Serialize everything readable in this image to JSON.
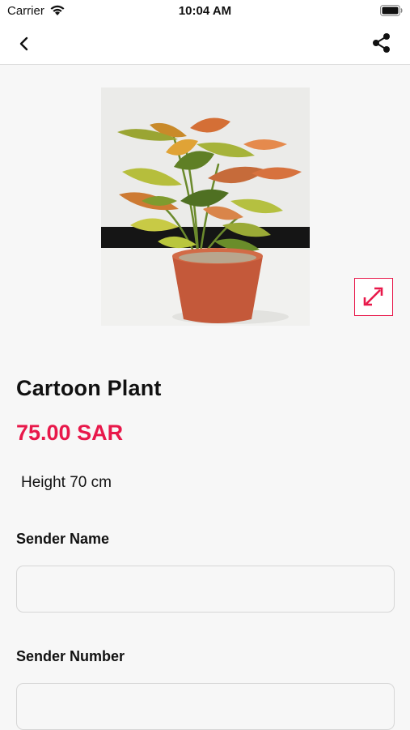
{
  "status_bar": {
    "carrier": "Carrier",
    "time": "10:04 AM"
  },
  "icons": {
    "back": "chevron-left-icon",
    "share": "share-icon",
    "expand": "expand-arrows-icon"
  },
  "product": {
    "title": "Cartoon Plant",
    "price": "75.00 SAR",
    "description": "Height 70 cm",
    "image_alt": "croton plant in terracotta pot"
  },
  "form": {
    "sender_name_label": "Sender Name",
    "sender_name_value": "",
    "sender_number_label": "Sender Number",
    "sender_number_value": ""
  },
  "colors": {
    "accent": "#e8184a",
    "background": "#f7f7f7",
    "header": "#ffffff"
  }
}
